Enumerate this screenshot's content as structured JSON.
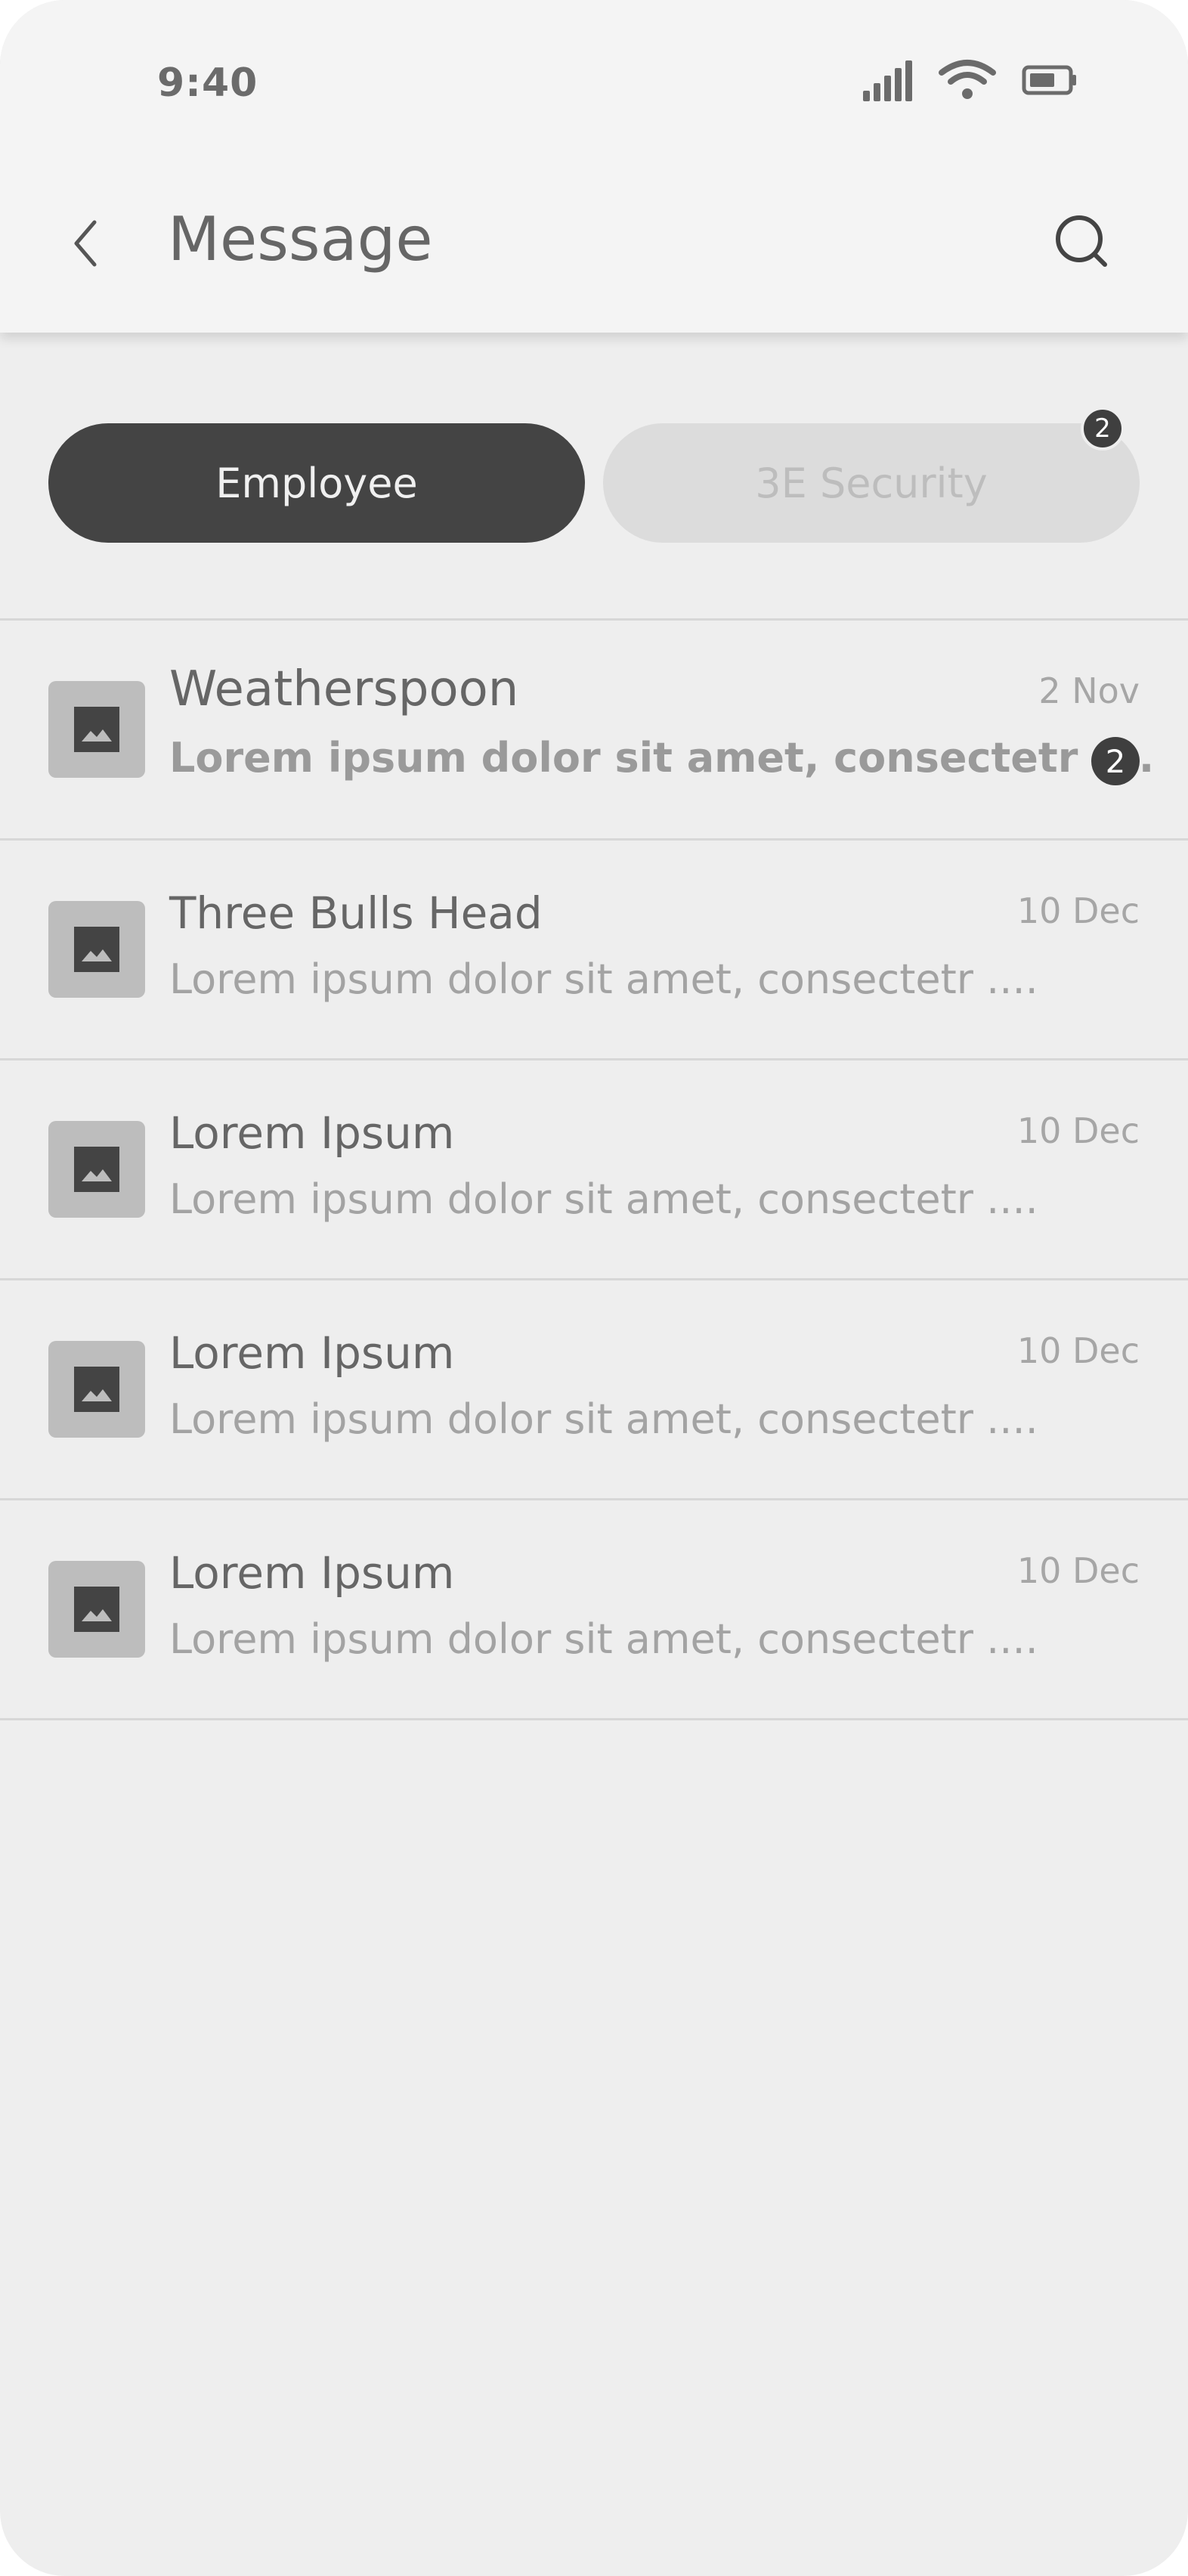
{
  "status_bar": {
    "time": "9:40",
    "icons": [
      "signal-icon",
      "wifi-icon",
      "battery-icon"
    ]
  },
  "header": {
    "title": "Message",
    "back_icon": "chevron-left-icon",
    "search_icon": "search-icon"
  },
  "tabs": [
    {
      "label": "Employee",
      "active": true
    },
    {
      "label": "3E Security",
      "active": false,
      "badge": "2"
    }
  ],
  "messages": [
    {
      "title": "Weatherspoon",
      "preview": "Lorem ipsum dolor sit amet, consectetr ....",
      "date": "2 Nov",
      "unread_count": "2"
    },
    {
      "title": "Three Bulls Head",
      "preview": "Lorem ipsum dolor sit amet, consectetr ....",
      "date": "10 Dec"
    },
    {
      "title": "Lorem Ipsum",
      "preview": "Lorem ipsum dolor sit amet, consectetr ....",
      "date": "10 Dec"
    },
    {
      "title": "Lorem Ipsum",
      "preview": "Lorem ipsum dolor sit amet, consectetr ....",
      "date": "10 Dec"
    },
    {
      "title": "Lorem Ipsum",
      "preview": "Lorem ipsum dolor sit amet, consectetr ....",
      "date": "10 Dec"
    }
  ],
  "colors": {
    "background": "#eeeeee",
    "header": "#f4f4f4",
    "active_tab": "#444444",
    "inactive_tab": "#dcdcdc",
    "badge": "#3f3f3f"
  }
}
